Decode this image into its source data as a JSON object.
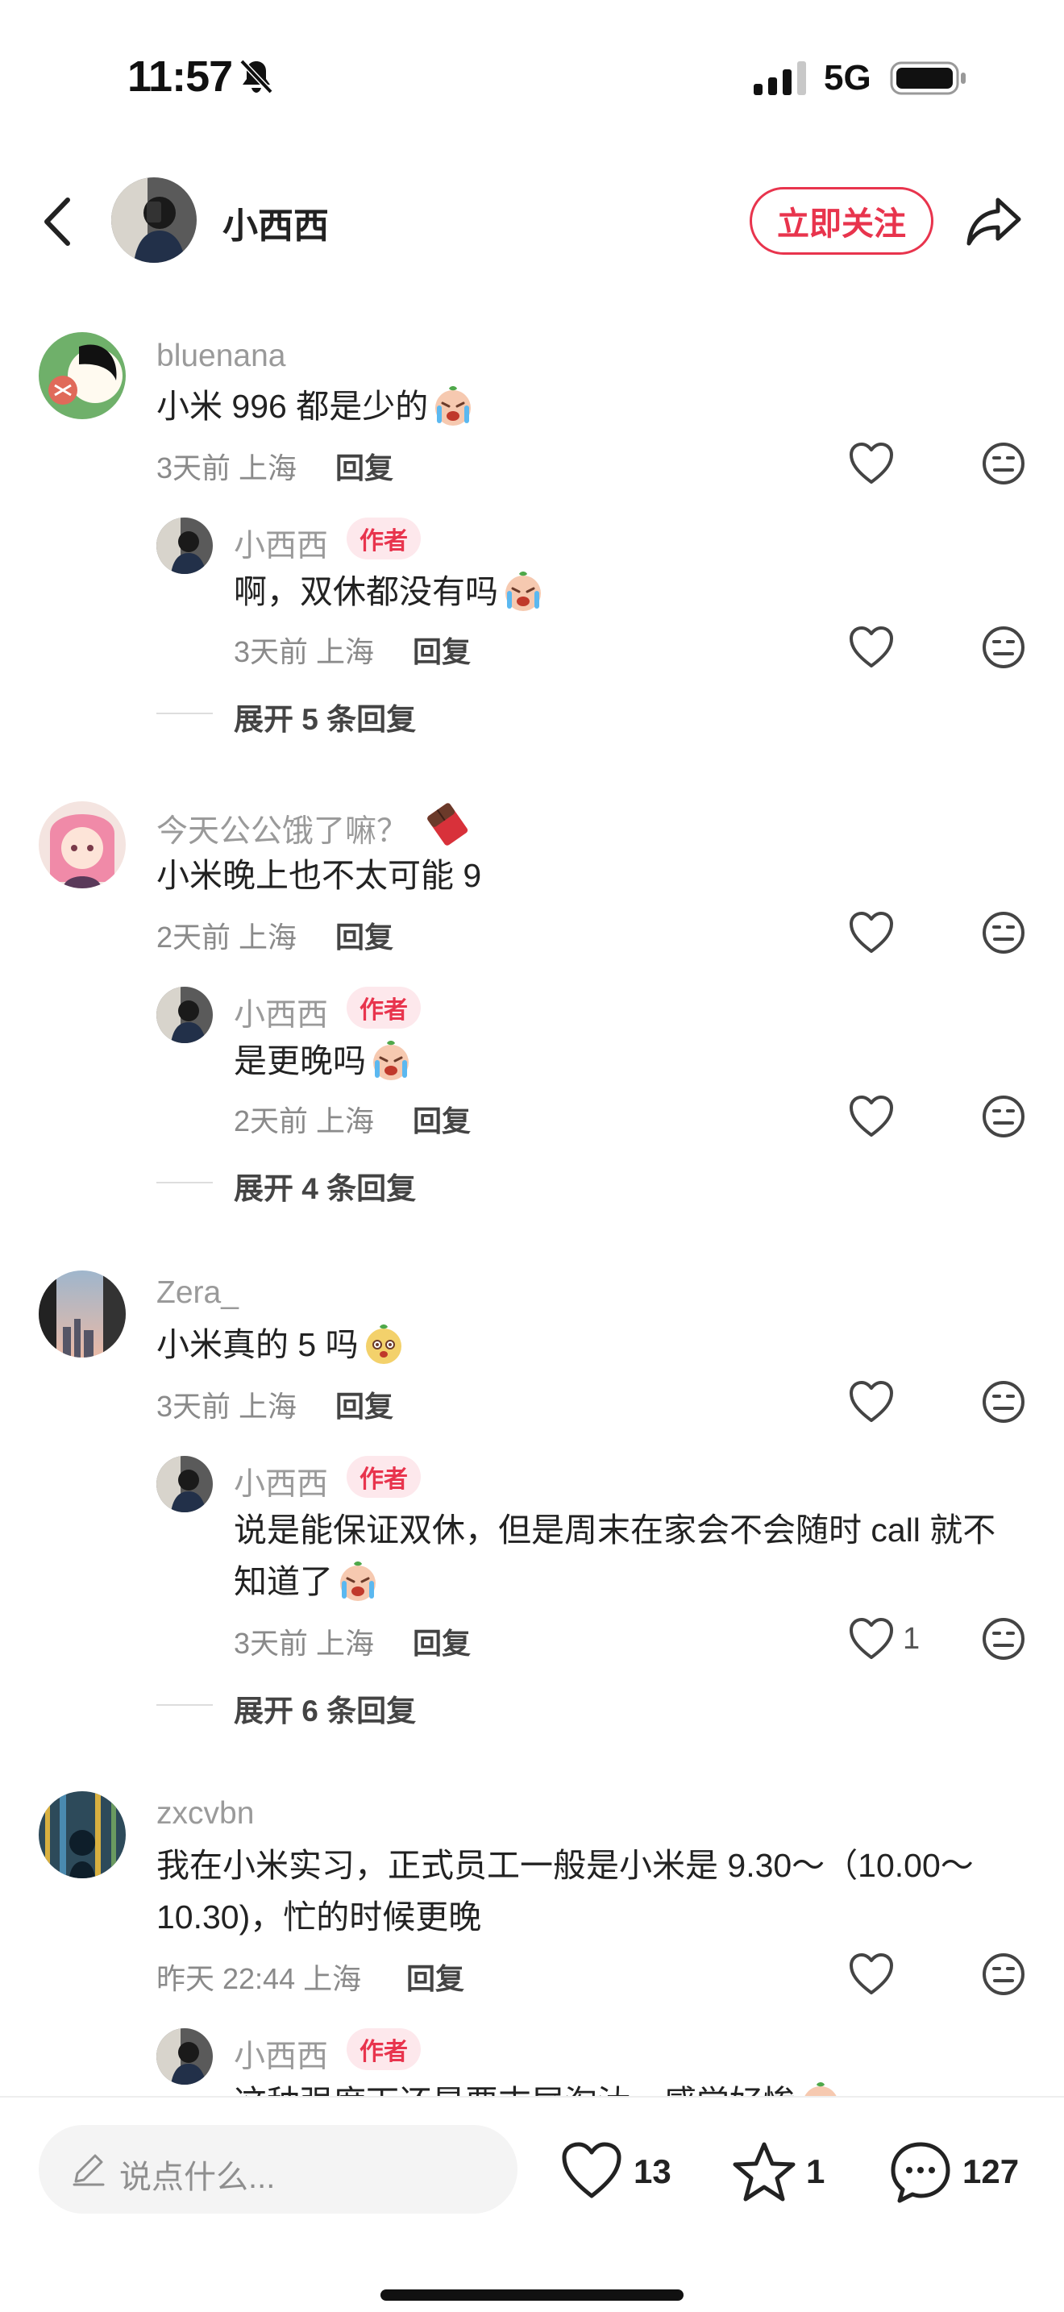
{
  "status_bar": {
    "time": "11:57",
    "network": "5G"
  },
  "header": {
    "username": "小西西",
    "follow_label": "立即关注"
  },
  "comments": [
    {
      "username": "bluenana",
      "text": "小米 996 都是少的",
      "time": "3天前",
      "location": "上海",
      "reply_label": "回复",
      "reply": {
        "username": "小西西",
        "tag": "作者",
        "text": "啊，双休都没有吗",
        "time": "3天前",
        "location": "上海",
        "reply_label": "回复"
      },
      "expand_label": "展开 5 条回复"
    },
    {
      "username": "今天公公饿了嘛？",
      "text": "小米晚上也不太可能 9",
      "time": "2天前",
      "location": "上海",
      "reply_label": "回复",
      "reply": {
        "username": "小西西",
        "tag": "作者",
        "text": "是更晚吗",
        "time": "2天前",
        "location": "上海",
        "reply_label": "回复"
      },
      "expand_label": "展开 4 条回复"
    },
    {
      "username": "Zera_",
      "text": "小米真的 5 吗",
      "time": "3天前",
      "location": "上海",
      "reply_label": "回复",
      "reply": {
        "username": "小西西",
        "tag": "作者",
        "text_line1": "说是能保证双休，但是周末在家会不会随时 call 就不",
        "text_line2": "知道了",
        "time": "3天前",
        "location": "上海",
        "reply_label": "回复",
        "like_count": "1"
      },
      "expand_label": "展开 6 条回复"
    },
    {
      "username": "zxcvbn",
      "text_line1": "我在小米实习，正式员工一般是小米是 9.30～（10.00～",
      "text_line2": "10.30)，忙的时候更晚",
      "time": "昨天 22:44",
      "location": "上海",
      "reply_label": "回复",
      "reply": {
        "username": "小西西",
        "tag": "作者",
        "text": "这种强度下还是要末尾淘汰，感觉好惨"
      }
    }
  ],
  "bottom_bar": {
    "input_placeholder": "说点什么...",
    "like_count": "13",
    "collect_count": "1",
    "comment_count": "127"
  },
  "colors": {
    "accent": "#e8344d",
    "tag_bg": "#fde8ec",
    "muted": "#9a9a9a"
  },
  "icons": [
    "bell-slash-icon",
    "signal-icon",
    "battery-icon",
    "back-icon",
    "share-icon",
    "heart-icon",
    "meh-face-icon",
    "crying-emoji-icon",
    "chocolate-emoji-icon",
    "pencil-icon",
    "star-icon",
    "chat-bubble-icon"
  ]
}
